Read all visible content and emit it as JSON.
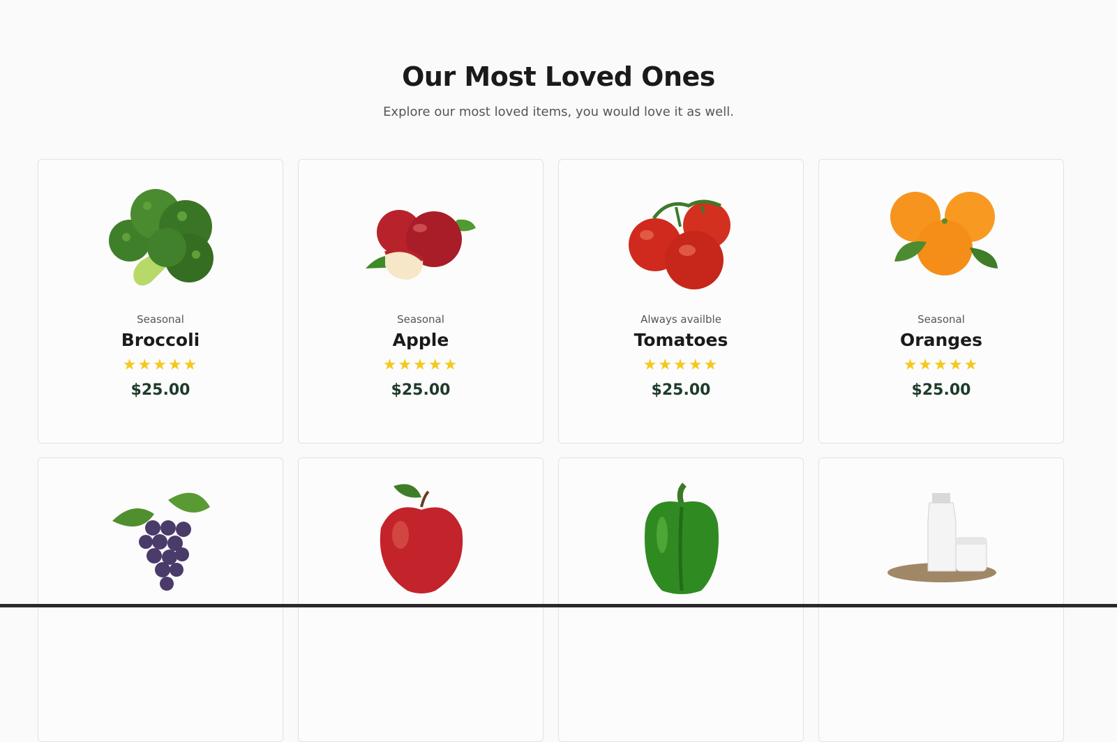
{
  "header": {
    "title": "Our Most Loved Ones",
    "subtitle": "Explore our most loved items, you would love it as well."
  },
  "products": [
    {
      "tag": "Seasonal",
      "name": "Broccoli",
      "stars": "★★★★★",
      "price": "$25.00",
      "icon": "broccoli-icon"
    },
    {
      "tag": "Seasonal",
      "name": "Apple",
      "stars": "★★★★★",
      "price": "$25.00",
      "icon": "apple-icon"
    },
    {
      "tag": "Always availble",
      "name": "Tomatoes",
      "stars": "★★★★★",
      "price": "$25.00",
      "icon": "tomatoes-icon"
    },
    {
      "tag": "Seasonal",
      "name": "Oranges",
      "stars": "★★★★★",
      "price": "$25.00",
      "icon": "oranges-icon"
    }
  ],
  "products_row2_icons": [
    "grapes-icon",
    "red-apple-icon",
    "green-pepper-icon",
    "milk-icon"
  ],
  "colors": {
    "star": "#f4c81c",
    "price": "#1f3b2a",
    "background": "#fafafa"
  }
}
